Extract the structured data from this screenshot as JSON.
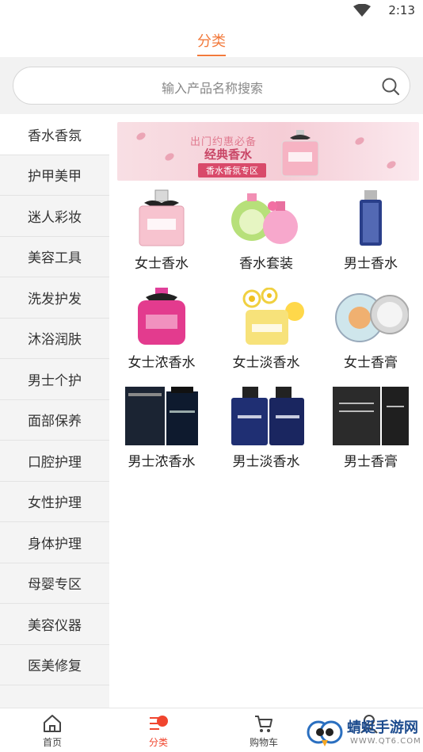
{
  "status_bar": {
    "time": "2:13"
  },
  "header": {
    "title": "分类"
  },
  "search": {
    "placeholder": "输入产品名称搜索"
  },
  "sidebar": {
    "items": [
      {
        "label": "香水香氛",
        "active": true
      },
      {
        "label": "护甲美甲"
      },
      {
        "label": "迷人彩妆"
      },
      {
        "label": "美容工具"
      },
      {
        "label": "洗发护发"
      },
      {
        "label": "沐浴润肤"
      },
      {
        "label": "男士个护"
      },
      {
        "label": "面部保养"
      },
      {
        "label": "口腔护理"
      },
      {
        "label": "女性护理"
      },
      {
        "label": "身体护理"
      },
      {
        "label": "母婴专区"
      },
      {
        "label": "美容仪器"
      },
      {
        "label": "医美修复"
      }
    ]
  },
  "banner": {
    "line1": "出门约惠必备",
    "line2": "经典香水",
    "tag": "香水香氛专区"
  },
  "products": [
    {
      "label": "女士香水"
    },
    {
      "label": "香水套装"
    },
    {
      "label": "男士香水"
    },
    {
      "label": "女士浓香水"
    },
    {
      "label": "女士淡香水"
    },
    {
      "label": "女士香膏"
    },
    {
      "label": "男士浓香水"
    },
    {
      "label": "男士淡香水"
    },
    {
      "label": "男士香膏"
    }
  ],
  "bottom_nav": {
    "items": [
      {
        "label": "首页",
        "icon": "home-icon"
      },
      {
        "label": "分类",
        "icon": "category-icon",
        "active": true
      },
      {
        "label": "购物车",
        "icon": "cart-icon"
      },
      {
        "label": "",
        "icon": "user-icon"
      }
    ]
  },
  "watermark": {
    "text": "蜻蜓手游网",
    "url": "WWW.QT6.COM"
  },
  "colors": {
    "accent": "#f27a3c",
    "nav_active": "#f0452e",
    "sidebar_bg": "#f4f4f4"
  }
}
